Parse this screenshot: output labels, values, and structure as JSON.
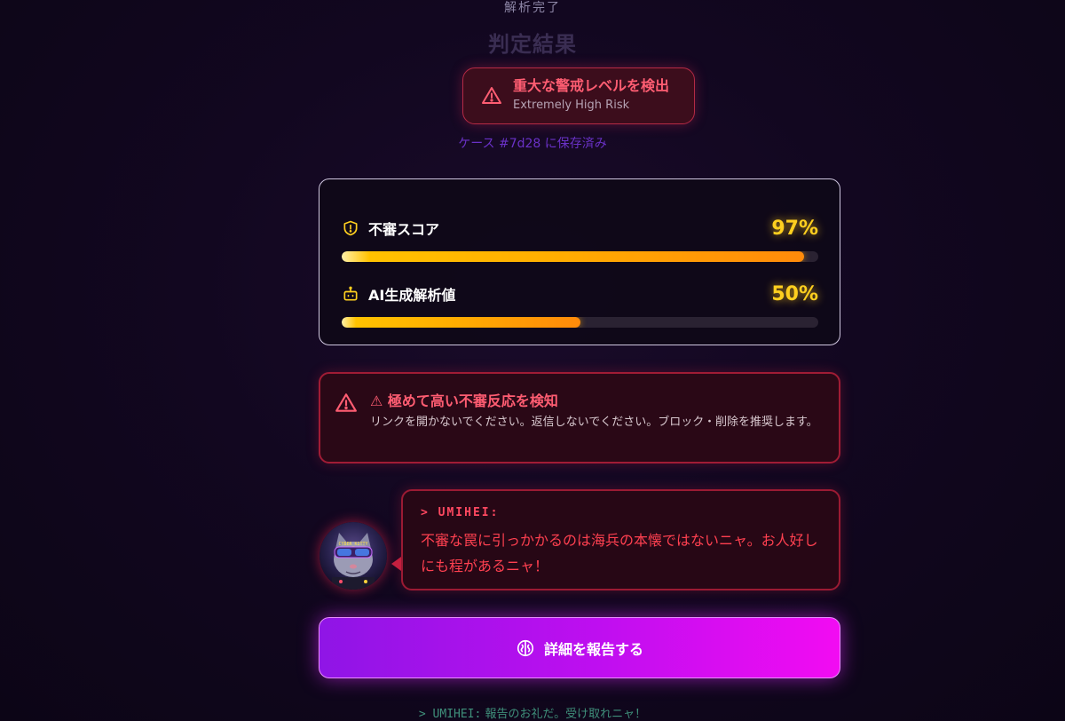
{
  "header": {
    "status": "解析完了",
    "title": "判定結果"
  },
  "alert_badge": {
    "title": "重大な警戒レベルを検出",
    "subtitle": "Extremely High Risk",
    "icon": "warning-triangle-icon",
    "color": "#ff5d72"
  },
  "case_saved": "ケース #7d28 に保存済み",
  "metrics": [
    {
      "label": "不審スコア",
      "value_text": "97%",
      "value": 97,
      "icon": "shield-alert-icon"
    },
    {
      "label": "AI生成解析値",
      "value_text": "50%",
      "value": 50,
      "icon": "robot-icon"
    }
  ],
  "warning": {
    "title": "⚠ 極めて高い不審反応を検知",
    "text": "リンクを開かないでください。返信しないでください。ブロック・削除を推奨します。",
    "icon": "warning-triangle-icon"
  },
  "chat": {
    "speaker": "> UMIHEI:",
    "message": "不審な罠に引っかかるのは海兵の本懐ではないニャ。お人好しにも程があるニャ！",
    "avatar_badge": "CYBER_KITTY"
  },
  "report_button": {
    "label": "詳細を報告する",
    "icon": "brain-icon"
  },
  "footer": {
    "prefix": "> UMIHEI:",
    "text": " 報告のお礼だ。受け取れニャ！"
  },
  "colors": {
    "accent_magenta": "#f20cf2",
    "accent_purple": "#8f15e6",
    "danger": "#ff4860",
    "score_yellow": "#ffcf1f"
  }
}
